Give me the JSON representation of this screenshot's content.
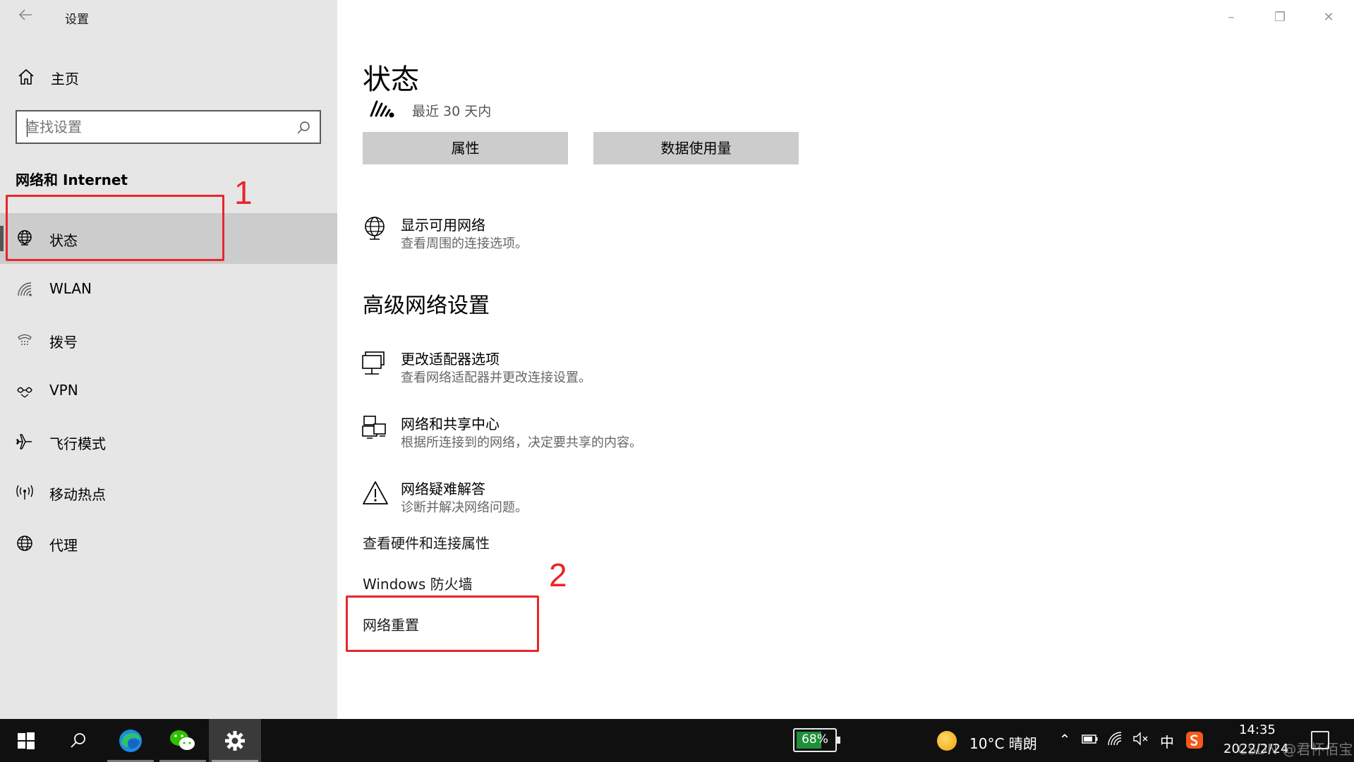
{
  "window": {
    "title": "设置",
    "controls": {
      "minimize": "–",
      "restore": "❐",
      "close": "✕"
    }
  },
  "sidebar": {
    "home_label": "主页",
    "search_placeholder": "查找设置",
    "section_title": "网络和 Internet",
    "items": [
      {
        "label": "状态",
        "icon": "globe-icon",
        "selected": true
      },
      {
        "label": "WLAN",
        "icon": "wifi-icon",
        "selected": false
      },
      {
        "label": "拨号",
        "icon": "dialup-icon",
        "selected": false
      },
      {
        "label": "VPN",
        "icon": "vpn-icon",
        "selected": false
      },
      {
        "label": "飞行模式",
        "icon": "airplane-icon",
        "selected": false
      },
      {
        "label": "移动热点",
        "icon": "hotspot-icon",
        "selected": false
      },
      {
        "label": "代理",
        "icon": "proxy-globe-icon",
        "selected": false
      }
    ]
  },
  "main": {
    "title": "状态",
    "wifi_summary": "最近 30 天内",
    "buttons": {
      "properties": "属性",
      "data_usage": "数据使用量"
    },
    "show_networks": {
      "title": "显示可用网络",
      "desc": "查看周围的连接选项。"
    },
    "advanced_title": "高级网络设置",
    "advanced_items": [
      {
        "title": "更改适配器选项",
        "desc": "查看网络适配器并更改连接设置。",
        "icon": "adapter-icon"
      },
      {
        "title": "网络和共享中心",
        "desc": "根据所连接到的网络，决定要共享的内容。",
        "icon": "sharing-center-icon"
      },
      {
        "title": "网络疑难解答",
        "desc": "诊断并解决网络问题。",
        "icon": "warning-icon"
      }
    ],
    "links": {
      "hardware": "查看硬件和连接属性",
      "firewall": "Windows 防火墙",
      "reset": "网络重置"
    }
  },
  "annotations": {
    "one": "1",
    "two": "2",
    "color": "#e8262a"
  },
  "taskbar": {
    "battery_text": "68%",
    "battery_level": 0.68,
    "weather": "10°C 晴朗",
    "tray": {
      "chevron": "⌃",
      "ime": "中"
    },
    "time": "14:35",
    "date": "2022/2/24",
    "watermark": "CSDN @君怀佰宝"
  },
  "colors": {
    "sidebar_bg": "#e6e6e6",
    "selected_bg": "#cccccc",
    "button_bg": "#cccccc",
    "taskbar_bg": "#101010"
  }
}
